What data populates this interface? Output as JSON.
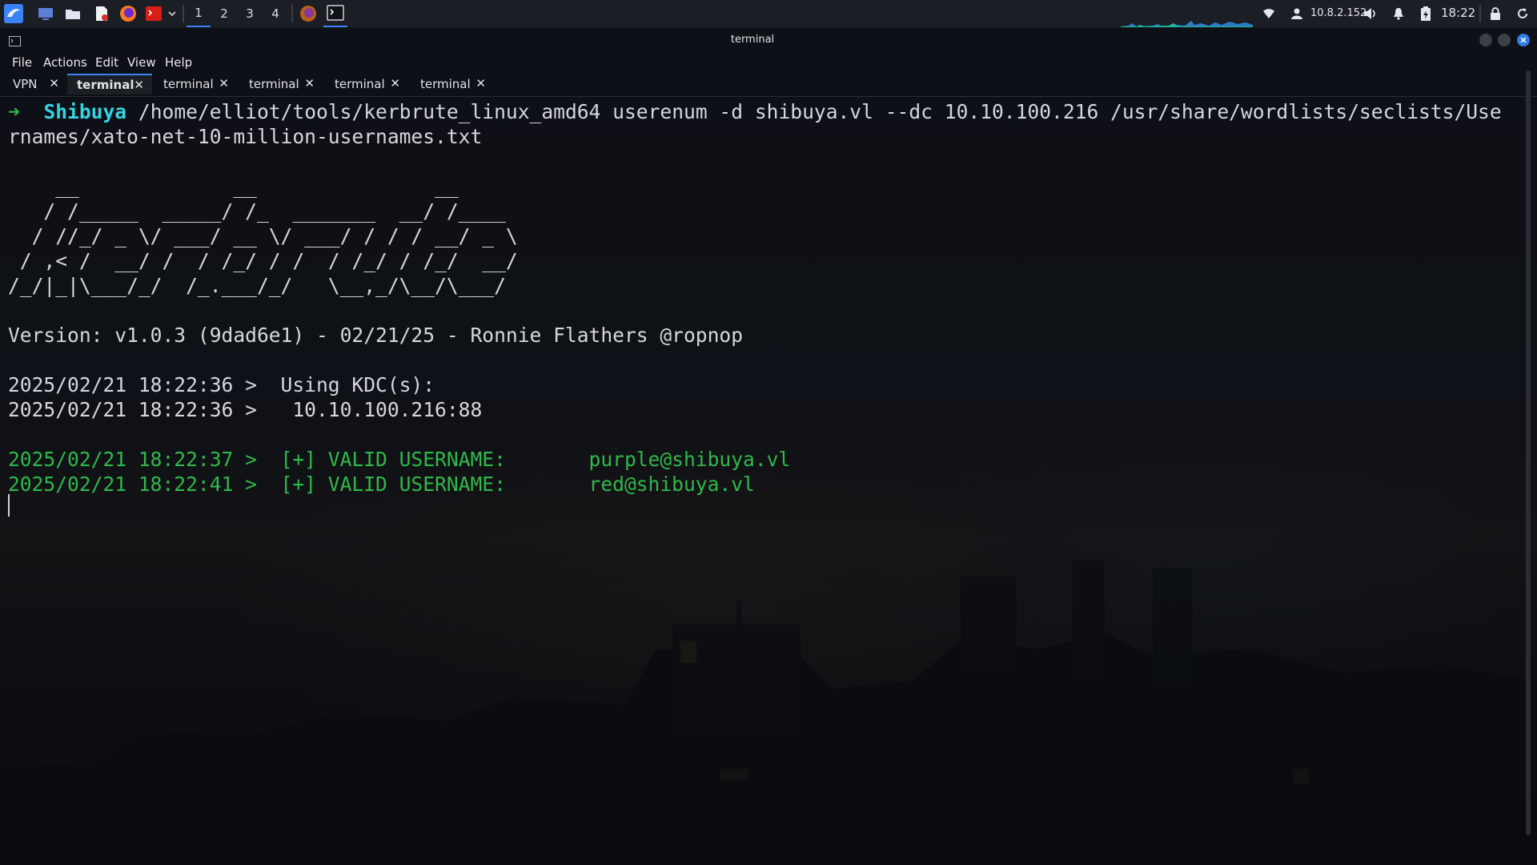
{
  "panel": {
    "workspaces": [
      "1",
      "2",
      "3",
      "4"
    ],
    "active_workspace": "1",
    "ip": "10.8.2.152",
    "clock": "18:22"
  },
  "window": {
    "title": "terminal",
    "menu": [
      "File",
      "Actions",
      "Edit",
      "View",
      "Help"
    ],
    "tabs": [
      {
        "label": "VPN",
        "active": false
      },
      {
        "label": "terminal",
        "active": true
      },
      {
        "label": "terminal",
        "active": false
      },
      {
        "label": "terminal",
        "active": false
      },
      {
        "label": "terminal",
        "active": false
      },
      {
        "label": "terminal",
        "active": false
      }
    ],
    "tab_close": "✕"
  },
  "terminal": {
    "prompt_arrow": "➜",
    "prompt_dir": "Shibuya",
    "command_line1": "/home/elliot/tools/kerbrute_linux_amd64 userenum -d shibuya.vl --dc 10.10.100.216 /usr/share/wordlists/seclists/Use",
    "command_line2": "rnames/xato-net-10-million-usernames.txt",
    "banner": [
      "    __             __               __     ",
      "   / /_____  _____/ /_  _______  __/ /____ ",
      "  / //_/ _ \\/ ___/ __ \\/ ___/ / / / __/ _ \\",
      " / ,< /  __/ /  / /_/ / /  / /_/ / /_/  __/",
      "/_/|_|\\___/_/  /_.___/_/   \\__,_/\\__/\\___/ "
    ],
    "version": "Version: v1.0.3 (9dad6e1) - 02/21/25 - Ronnie Flathers @ropnop",
    "kdc_line1": "2025/02/21 18:22:36 >  Using KDC(s):",
    "kdc_line2": "2025/02/21 18:22:36 >   10.10.100.216:88",
    "valid1": "2025/02/21 18:22:37 >  [+] VALID USERNAME:       purple@shibuya.vl",
    "valid2": "2025/02/21 18:22:41 >  [+] VALID USERNAME:       red@shibuya.vl"
  },
  "colors": {
    "accent": "#3b82f6",
    "prompt_green": "#2fb84a",
    "prompt_dir": "#36d3e3",
    "valid_green": "#2fb84a"
  }
}
